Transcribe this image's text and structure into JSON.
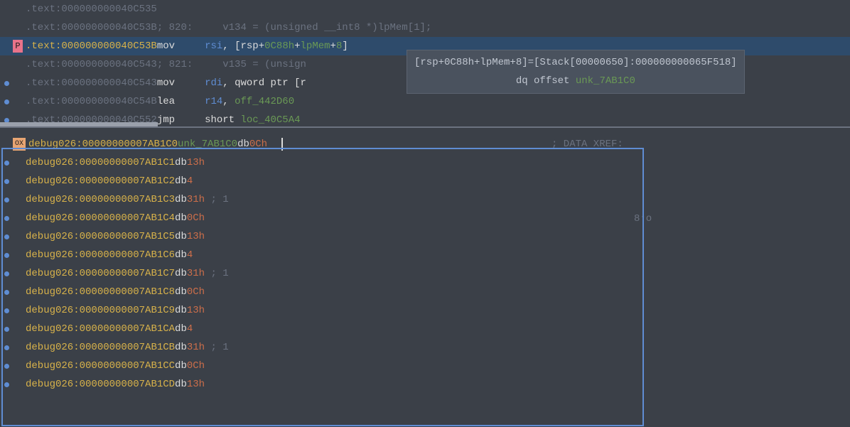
{
  "top": {
    "lines": [
      {
        "dot": false,
        "tag": "",
        "addr": ".text:000000000040C535",
        "gray": true,
        "kind": "addr-only"
      },
      {
        "dot": false,
        "tag": "",
        "addr": ".text:000000000040C53B",
        "gray": true,
        "kind": "cmt",
        "cmt": "; 820:     v134 = (unsigned __int8 *)lpMem[1];"
      },
      {
        "dot": false,
        "tag": "P",
        "addr": ".text:000000000040C53B",
        "gray": false,
        "kind": "mov-rsi",
        "mnem": "mov",
        "dst": "rsi",
        "p1": "[rsp+",
        "n1": "0C88h",
        "p2": "+",
        "sym": "lpMem",
        "p3": "+",
        "n2": "8",
        "p4": "]",
        "hl": true
      },
      {
        "dot": false,
        "tag": "",
        "addr": ".text:000000000040C543",
        "gray": true,
        "kind": "cmt",
        "cmt": "; 821:     v135 = (unsign"
      },
      {
        "dot": true,
        "tag": "",
        "addr": ".text:000000000040C543",
        "gray": true,
        "kind": "mov-rdi",
        "mnem": "mov",
        "dst": "rdi",
        "rest": ", qword ptr [r"
      },
      {
        "dot": true,
        "tag": "",
        "addr": ".text:000000000040C54B",
        "gray": true,
        "kind": "lea",
        "mnem": "lea",
        "dst": "r14",
        "sep": ", ",
        "sym": "off_442D60"
      },
      {
        "dot": true,
        "tag": "",
        "addr": ".text:000000000040C552",
        "gray": true,
        "kind": "jmp",
        "mnem": "jmp",
        "sep": "short ",
        "sym": "loc_40C5A4"
      }
    ]
  },
  "tooltip": {
    "line1_a": "[rsp+0C88h+lpMem+8]=[Stack[00000650]:000000000065F518]",
    "line2_a": "dq offset ",
    "line2_b": "unk_7AB1C0"
  },
  "bottom": {
    "first": {
      "tag": "OX",
      "seg": "debug026:",
      "addr": "00000000007AB1C0",
      "label": "unk_7AB1C0",
      "db": "db",
      "val": "0Ch",
      "xref": "; DATA XREF:"
    },
    "lines": [
      {
        "addr": "00000000007AB1C1",
        "val": "13h",
        "sfx": ""
      },
      {
        "addr": "00000000007AB1C2",
        "val": "4",
        "sfx": ""
      },
      {
        "addr": "00000000007AB1C3",
        "val": "31h",
        "sfx": " ; 1"
      },
      {
        "addr": "00000000007AB1C4",
        "val": "0Ch",
        "sfx": ""
      },
      {
        "addr": "00000000007AB1C5",
        "val": "13h",
        "sfx": ""
      },
      {
        "addr": "00000000007AB1C6",
        "val": "4",
        "sfx": ""
      },
      {
        "addr": "00000000007AB1C7",
        "val": "31h",
        "sfx": " ; 1"
      },
      {
        "addr": "00000000007AB1C8",
        "val": "0Ch",
        "sfx": ""
      },
      {
        "addr": "00000000007AB1C9",
        "val": "13h",
        "sfx": ""
      },
      {
        "addr": "00000000007AB1CA",
        "val": "4",
        "sfx": ""
      },
      {
        "addr": "00000000007AB1CB",
        "val": "31h",
        "sfx": " ; 1"
      },
      {
        "addr": "00000000007AB1CC",
        "val": "0Ch",
        "sfx": ""
      },
      {
        "addr": "00000000007AB1CD",
        "val": "13h",
        "sfx": ""
      }
    ],
    "seg": "debug026:",
    "db": "db",
    "xref_extra": "8↑o"
  }
}
